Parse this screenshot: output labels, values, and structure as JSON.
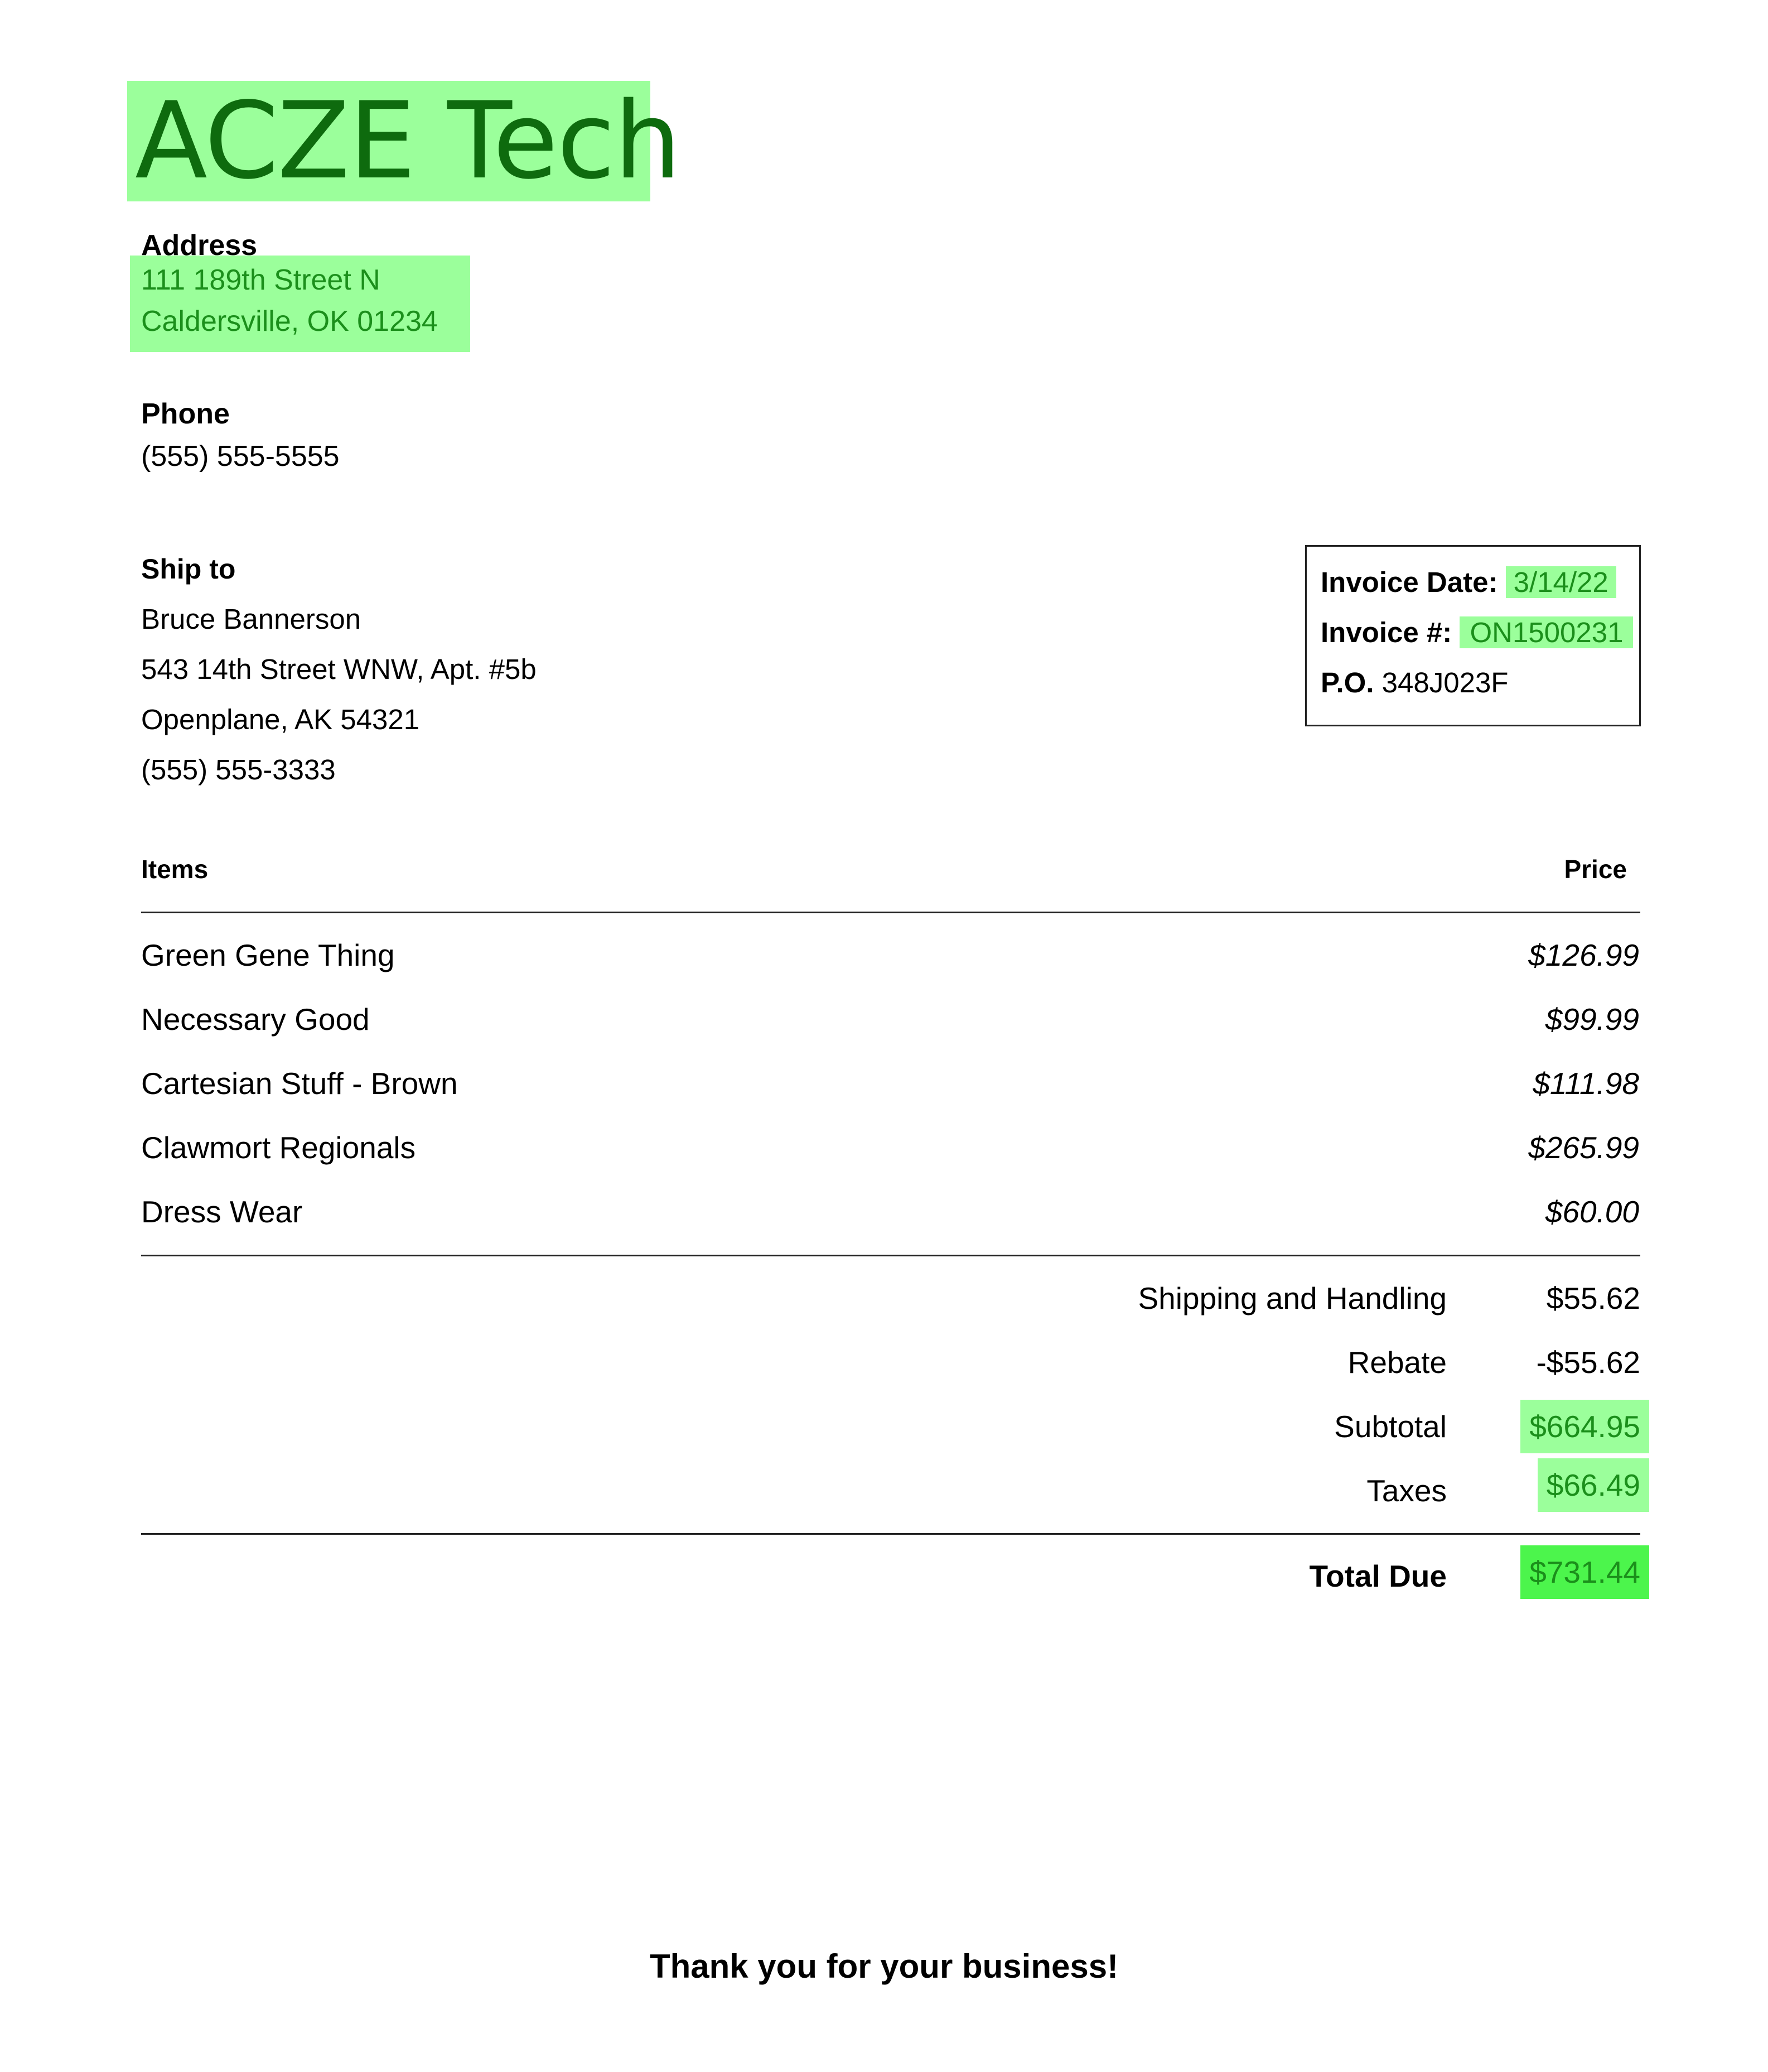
{
  "company": {
    "name": "ACZE Tech"
  },
  "address": {
    "label": "Address",
    "line1": "111 189th Street N",
    "line2": "Caldersville, OK 01234"
  },
  "phone": {
    "label": "Phone",
    "value": "(555) 555-5555"
  },
  "ship_to": {
    "label": "Ship to",
    "name": "Bruce Bannerson",
    "street": "543 14th Street WNW, Apt. #5b",
    "city": "Openplane, AK 54321",
    "phone": "(555) 555-3333"
  },
  "invoice": {
    "date_label": "Invoice Date:",
    "date_value": "3/14/22",
    "number_label": "Invoice #:",
    "number_value": "ON1500231",
    "po_label": "P.O.",
    "po_value": "348J023F"
  },
  "items_table": {
    "headers": {
      "items": "Items",
      "price": "Price"
    },
    "rows": [
      {
        "name": "Green Gene Thing",
        "price": "$126.99"
      },
      {
        "name": "Necessary Good",
        "price": "$99.99"
      },
      {
        "name": "Cartesian Stuff - Brown",
        "price": "$111.98"
      },
      {
        "name": "Clawmort Regionals",
        "price": "$265.99"
      },
      {
        "name": "Dress Wear",
        "price": "$60.00"
      }
    ]
  },
  "summary": {
    "shipping_label": "Shipping and Handling",
    "shipping_value": "$55.62",
    "rebate_label": "Rebate",
    "rebate_value": "-$55.62",
    "subtotal_label": "Subtotal",
    "subtotal_value": "$664.95",
    "taxes_label": "Taxes",
    "taxes_value": "$66.49",
    "total_label": "Total Due",
    "total_value": "$731.44"
  },
  "footer": {
    "thanks": "Thank you for your business!"
  },
  "colors": {
    "highlight": "#9bff9b",
    "highlight_strong": "#4cf54c",
    "highlight_text": "#1b8f1b",
    "logo_text": "#0e6b0e"
  }
}
